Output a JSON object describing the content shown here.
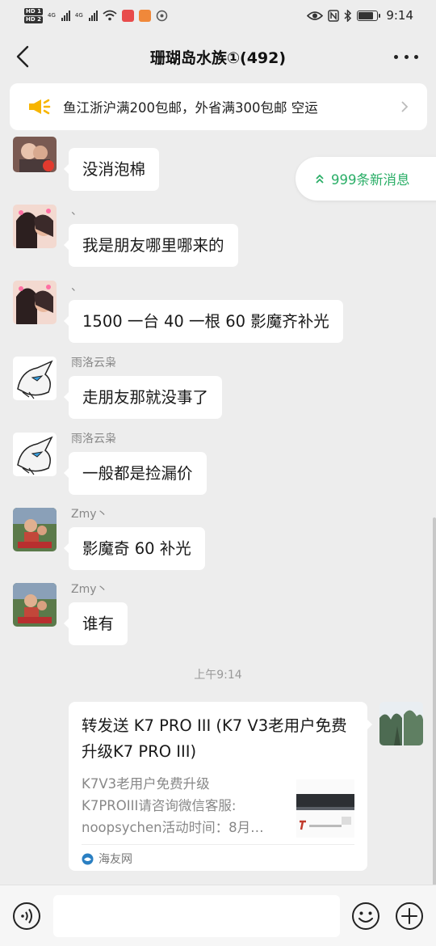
{
  "status_bar": {
    "time": "9:14",
    "hd1": "HD 1",
    "hd2": "HD 2",
    "net1": "4G",
    "net2": "4G"
  },
  "header": {
    "title": "珊瑚岛水族①(492)"
  },
  "notice": {
    "text": "鱼江浙沪满200包邮，外省满300包邮  空运"
  },
  "new_messages": {
    "label": "999条新消息"
  },
  "messages": [
    {
      "sender": "",
      "text": "没消泡棉"
    },
    {
      "sender": "、",
      "text": "我是朋友哪里哪来的"
    },
    {
      "sender": "、",
      "text": "1500 一台 40 一根 60 影魔齐补光"
    },
    {
      "sender": "雨洛云枭",
      "text": "走朋友那就没事了"
    },
    {
      "sender": "雨洛云枭",
      "text": "一般都是捡漏价"
    },
    {
      "sender": "Zmy丶",
      "text": "影魔奇 60 补光"
    },
    {
      "sender": "Zmy丶",
      "text": "谁有"
    }
  ],
  "time_label": "上午9:14",
  "link_card": {
    "title": "转发送 K7 PRO III (K7 V3老用户免费升级K7 PRO III)",
    "desc_lines": [
      "K7V3老用户免费升级",
      "K7PROIII请咨询微信客服:",
      "noopsychen活动时间：8月…"
    ],
    "source": "海友网"
  },
  "input": {
    "placeholder": ""
  }
}
